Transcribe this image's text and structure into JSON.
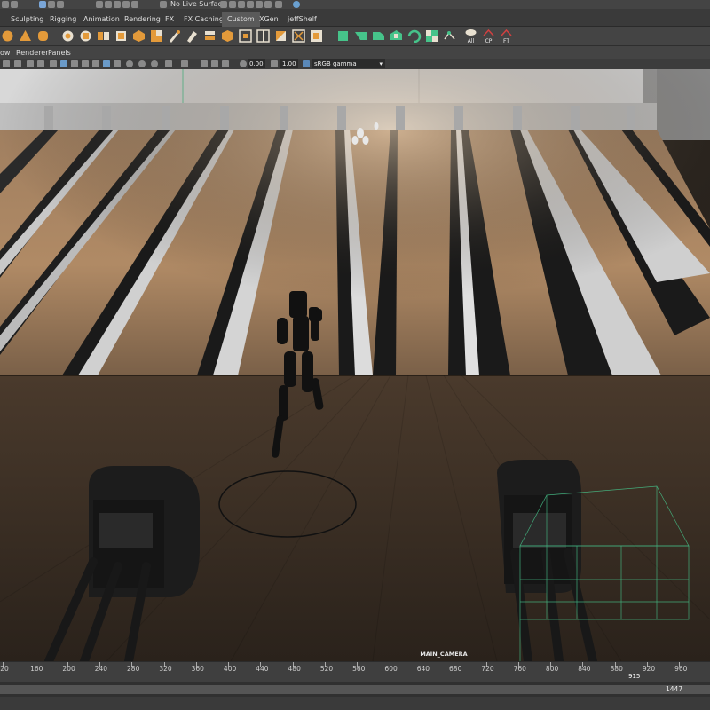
{
  "status_bar": {
    "live_surface": "No Live Surface"
  },
  "shelf_tabs": [
    {
      "label": "Sculpting",
      "active": false
    },
    {
      "label": "Rigging",
      "active": false
    },
    {
      "label": "Animation",
      "active": false
    },
    {
      "label": "Rendering",
      "active": false
    },
    {
      "label": "FX",
      "active": false
    },
    {
      "label": "FX Caching",
      "active": false
    },
    {
      "label": "Custom",
      "active": true
    },
    {
      "label": "XGen",
      "active": false
    },
    {
      "label": "jeffShelf",
      "active": false
    }
  ],
  "shelf_tools": {
    "light_all": "All",
    "light_cp": "CP",
    "light_ft": "FT"
  },
  "panel_menu": [
    "ow",
    "Renderer",
    "Panels"
  ],
  "view_tools": {
    "exposure": "0.00",
    "gamma": "1.00",
    "color_space": "sRGB gamma"
  },
  "viewport": {
    "camera_name": "MAIN_CAMERA"
  },
  "timeline": {
    "ticks": [
      "20",
      "160",
      "200",
      "240",
      "280",
      "320",
      "360",
      "400",
      "440",
      "480",
      "520",
      "560",
      "600",
      "640",
      "680",
      "720",
      "760",
      "800",
      "840",
      "880",
      "920",
      "960"
    ],
    "current_frame": "915"
  },
  "range_slider": {
    "end_frame": "1447"
  },
  "colors": {
    "accent_green": "#46c38a",
    "ui_dark": "#444444",
    "lane_wood": "#b38c65",
    "approach_floor": "#3b2f25"
  }
}
